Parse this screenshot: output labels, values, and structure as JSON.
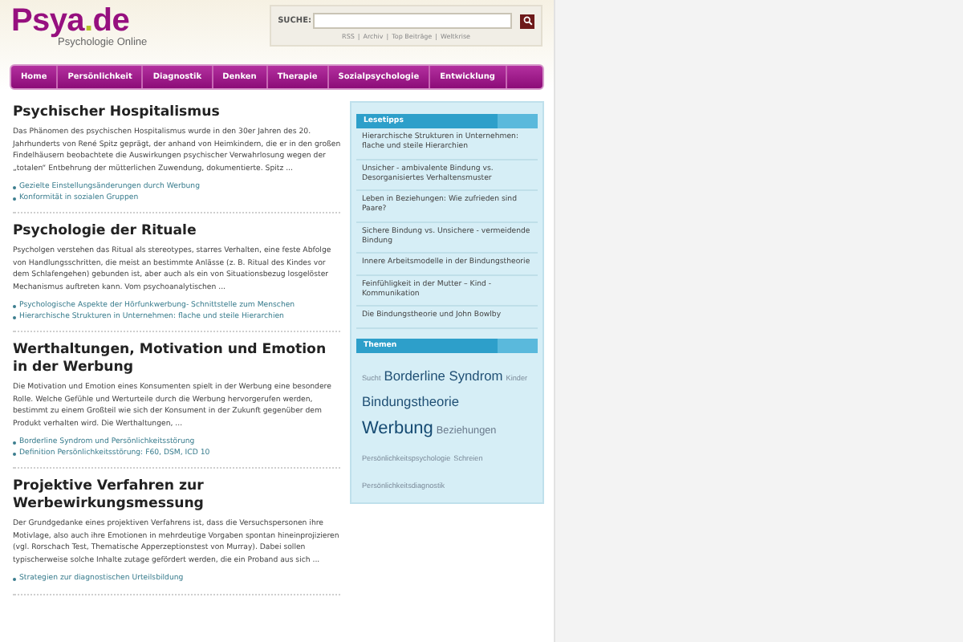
{
  "logo": {
    "name": "Psya",
    "dot": ".",
    "tld": "de",
    "tagline": "Psychologie Online"
  },
  "search": {
    "label": "SUCHE:"
  },
  "meta_links": [
    "RSS",
    "Archiv",
    "Top Beiträge",
    "Weltkrise"
  ],
  "meta_separator": "|",
  "nav": [
    {
      "label": "Home",
      "selected": false
    },
    {
      "label": "Persönlichkeit",
      "selected": false
    },
    {
      "label": "Diagnostik",
      "selected": false
    },
    {
      "label": "Denken",
      "selected": false
    },
    {
      "label": "Therapie",
      "selected": false
    },
    {
      "label": "Sozialpsychologie",
      "selected": false
    },
    {
      "label": "Entwicklung",
      "selected": false
    }
  ],
  "articles": [
    {
      "title": "Psychischer Hospitalismus",
      "excerpt": "Das Phänomen des psychischen Hospitalismus wurde in den 30er Jahren des 20. Jahrhunderts von René Spitz geprägt, der anhand von Heimkindern, die er in den großen Findelhäusern beobachtete die Auswirkungen psychischer Verwahrlosung wegen der „totalen“ Entbehrung der mütterlichen Zuwendung, dokumentierte. Spitz ...",
      "links": [
        "Gezielte Einstellungsänderungen durch Werbung",
        "Konformität in sozialen Gruppen"
      ]
    },
    {
      "title": "Psychologie der Rituale",
      "excerpt": "Psycholgen verstehen das Ritual als stereotypes, starres Verhalten, eine feste Abfolge von Handlungsschritten, die meist an bestimmte Anlässe (z. B. Ritual des Kindes vor dem Schlafengehen) gebunden ist, aber auch als ein von Situationsbezug losgelöster Mechanismus auftreten kann. Vom psychoanalytischen ...",
      "links": [
        "Psychologische Aspekte der Hörfunkwerbung- Schnittstelle zum Menschen",
        "Hierarchische Strukturen in Unternehmen: flache und steile Hierarchien"
      ]
    },
    {
      "title": "Werthaltungen, Motivation und Emotion in der Werbung",
      "excerpt": "Die Motivation und Emotion eines Konsumenten spielt in der Werbung eine besondere Rolle. Welche Gefühle und Werturteile durch die Werbung hervorgerufen werden, bestimmt zu einem Großteil wie sich der Konsument in der Zukunft gegenüber dem Produkt verhalten wird. Die Werthaltungen, ...",
      "links": [
        "Borderline Syndrom und Persönlichkeitsstörung",
        "Definition Persönlichkeitsstörung: F60, DSM, ICD 10"
      ]
    },
    {
      "title": "Projektive Verfahren zur Werbewirkungsmessung",
      "excerpt": "Der Grundgedanke eines projektiven Verfahrens ist, dass die Versuchspersonen ihre Motivlage, also auch ihre Emotionen in mehrdeutige Vorgaben spontan hineinprojizieren (vgl. Rorschach Test, Thematische Apperzeptionstest von Murray). Dabei sollen typischerweise solche Inhalte zutage gefördert werden, die ein Proband aus sich ...",
      "links": [
        "Strategien zur diagnostischen Urteilsbildung"
      ]
    }
  ],
  "sidebar": {
    "reading_tips": {
      "title": "Lesetipps",
      "items": [
        "Hierarchische Strukturen in Unternehmen: flache und steile Hierarchien",
        "Unsicher - ambivalente Bindung vs. Desorganisiertes Verhaltensmuster",
        "Leben in Beziehungen: Wie zufrieden sind Paare?",
        "Sichere Bindung vs. Unsichere - vermeidende Bindung",
        "Innere Arbeitsmodelle in der Bindungstheorie",
        "Feinfühligkeit in der Mutter – Kind - Kommunikation",
        "Die Bindungstheorie und John Bowlby"
      ]
    },
    "topics": {
      "title": "Themen",
      "tags": [
        {
          "label": "Sucht",
          "kind": "small"
        },
        {
          "label": "Borderline Syndrom",
          "kind": "large"
        },
        {
          "label": "Kinder",
          "kind": "small"
        },
        {
          "label": "Bindungstheorie",
          "kind": "large"
        },
        {
          "label": "Werbung",
          "kind": "huge"
        },
        {
          "label": "Beziehungen",
          "kind": "medium"
        },
        {
          "label": "Persönlichkeitspsychologie",
          "kind": "small"
        },
        {
          "label": "Schreien",
          "kind": "small"
        },
        {
          "label": "Persönlichkeitsdiagnostik",
          "kind": "small"
        }
      ]
    }
  }
}
